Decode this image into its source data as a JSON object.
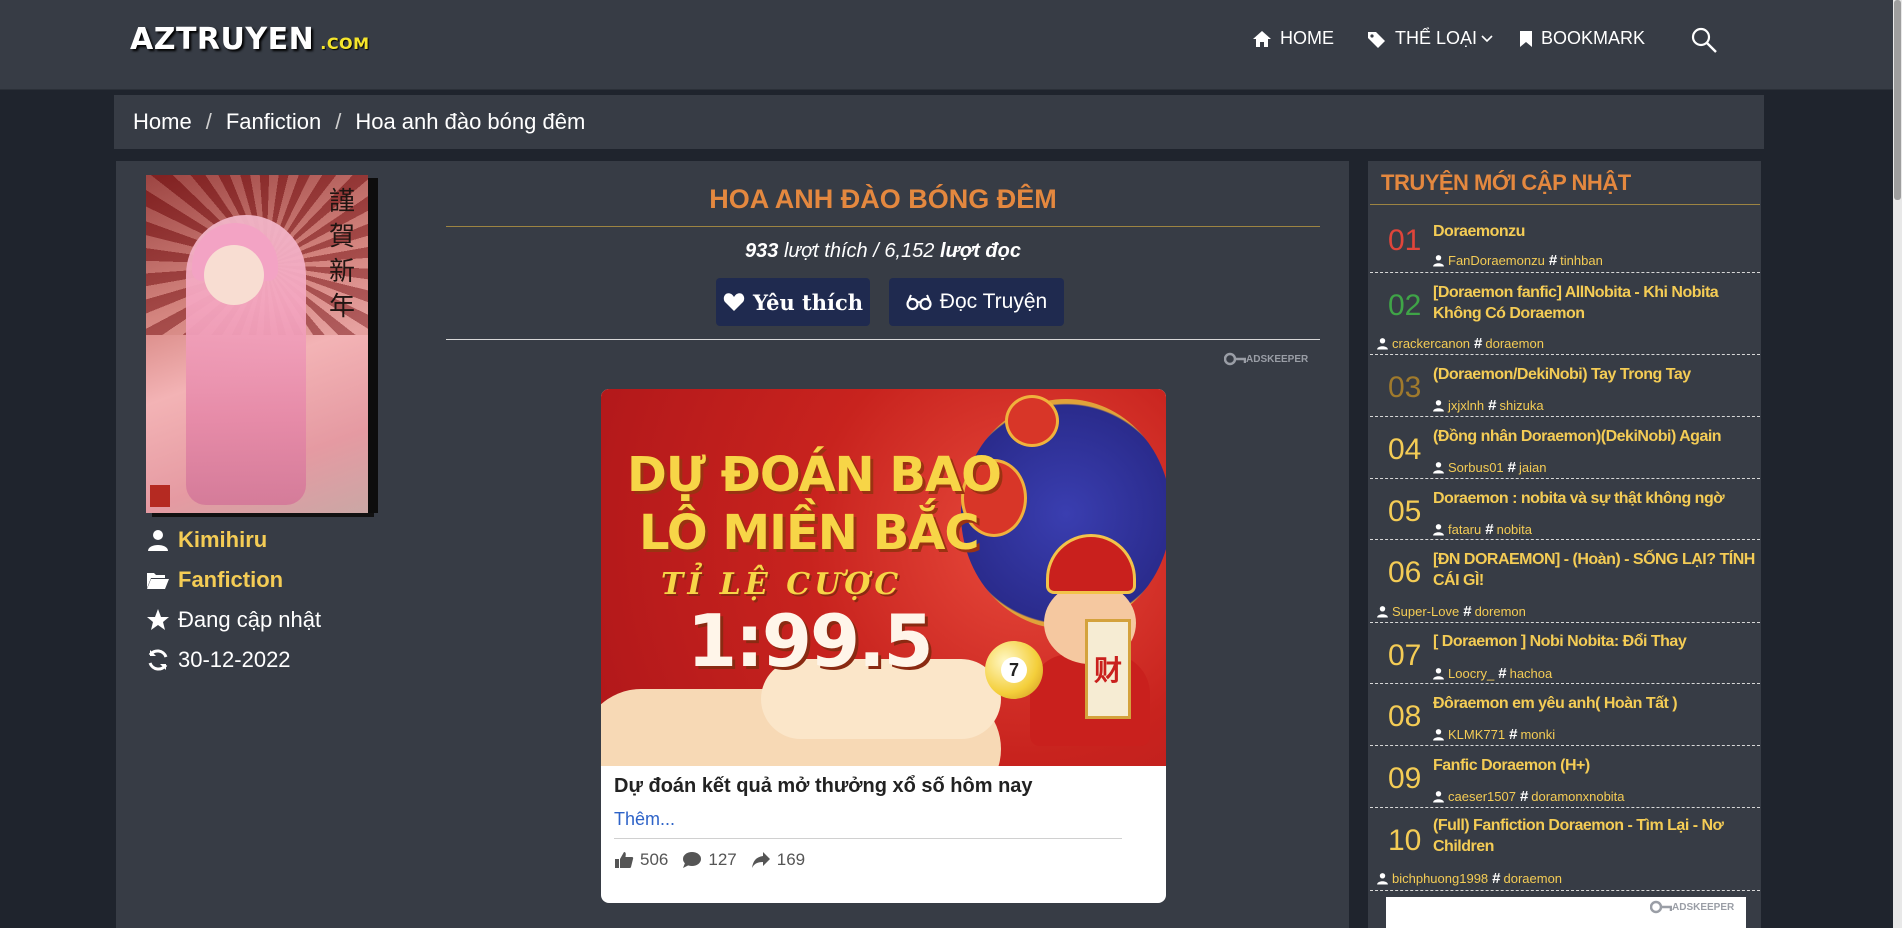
{
  "header": {
    "logo_main": "AZTRUYEN",
    "logo_domain": ".COM",
    "nav": {
      "home": "HOME",
      "genre": "THỂ LOẠI",
      "bookmark": "BOOKMARK"
    }
  },
  "breadcrumb": [
    "Home",
    "Fanfiction",
    "Hoa anh đào bóng đêm"
  ],
  "story": {
    "title": "HOA ANH ĐÀO BÓNG ĐÊM",
    "likes": "933",
    "likes_label": "lượt thích /",
    "reads": "6,152",
    "reads_label": "lượt đọc",
    "like_button": "Yêu thích",
    "read_button": "Đọc Truyện",
    "author": "Kimihiru",
    "genre": "Fanfiction",
    "status": "Đang cập nhật",
    "updated": "30-12-2022",
    "cover_kanji": "謹賀新年"
  },
  "ad": {
    "network": "ADSKEEPER",
    "headline_1": "DỰ ĐOÁN BAO",
    "headline_2": "LÔ MIỀN BẮC",
    "headline_3": "TỈ LỆ CƯỢC",
    "odds": "1:99.5",
    "ball_number": "7",
    "scroll_char": "财",
    "text": "Dự đoán kết quả mở thưởng xổ số hôm nay",
    "more": "Thêm...",
    "likes": "506",
    "comments": "127",
    "shares": "169"
  },
  "sidebar": {
    "title": "TRUYỆN MỚI CẬP NHẬT",
    "items": [
      {
        "num": "01",
        "color": "#e0453a",
        "title": "Doraemonzu",
        "author": "FanDoraemonzu",
        "tag": "tinhban"
      },
      {
        "num": "02",
        "color": "#3fa447",
        "title": "[Doraemon fanfic] AllNobita - Khi Nobita Không Có Doraemon",
        "author": "crackercanon",
        "tag": "doraemon"
      },
      {
        "num": "03",
        "color": "#a07a2c",
        "title": "(Doraemon/DekiNobi) Tay Trong Tay",
        "author": "jxjxlnh",
        "tag": "shizuka"
      },
      {
        "num": "04",
        "color": "#f4cc55",
        "title": "(Đồng nhân Doraemon)(DekiNobi) Again",
        "author": "Sorbus01",
        "tag": "jaian"
      },
      {
        "num": "05",
        "color": "#f4cc55",
        "title": "Doraemon : nobita và sự thật không ngờ",
        "author": "fataru",
        "tag": "nobita"
      },
      {
        "num": "06",
        "color": "#f4cc55",
        "title": "[ĐN DORAEMON] - (Hoàn) - SỐNG LẠI? TÍNH CÁI GÌ!",
        "author": "Super-Love",
        "tag": "doremon"
      },
      {
        "num": "07",
        "color": "#f4cc55",
        "title": "[ Doraemon ] Nobi Nobita: Đổi Thay",
        "author": "Loocry_",
        "tag": "hachoa"
      },
      {
        "num": "08",
        "color": "#f4cc55",
        "title": "Đôraemon em yêu anh( Hoàn Tất )",
        "author": "KLMK771",
        "tag": "monki"
      },
      {
        "num": "09",
        "color": "#f4cc55",
        "title": "Fanfic Doraemon (H+)",
        "author": "caeser1507",
        "tag": "doramonxnobita"
      },
      {
        "num": "10",
        "color": "#f4cc55",
        "title": "(Full) Fanfiction Doraemon - Tìm Lại - Nơ Children",
        "author": "bichphuong1998",
        "tag": "doraemon"
      }
    ]
  }
}
